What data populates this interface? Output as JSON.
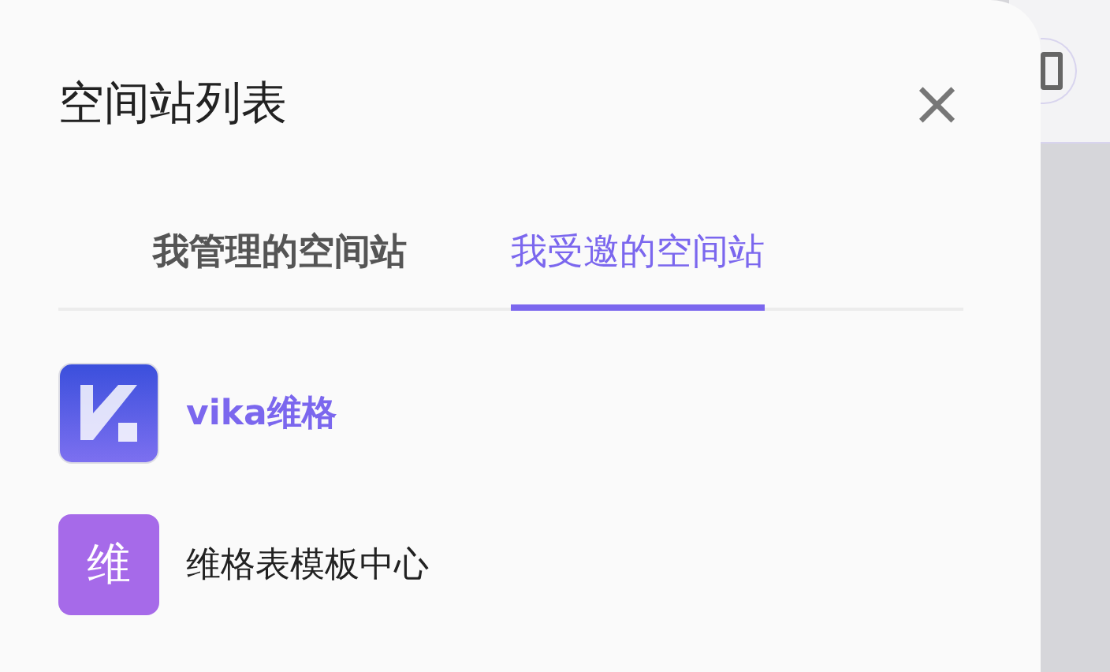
{
  "panel": {
    "title": "空间站列表",
    "close": "×"
  },
  "tabs": [
    {
      "label": "我管理的空间站",
      "selected": false
    },
    {
      "label": "我受邀的空间站",
      "selected": true
    }
  ],
  "spaces": [
    {
      "kind": "logo",
      "name": "vika维格",
      "selected": true
    },
    {
      "kind": "letter",
      "avatar": "维",
      "color": "#a66ae9",
      "name": "维格表模板中心",
      "selected": false
    }
  ]
}
